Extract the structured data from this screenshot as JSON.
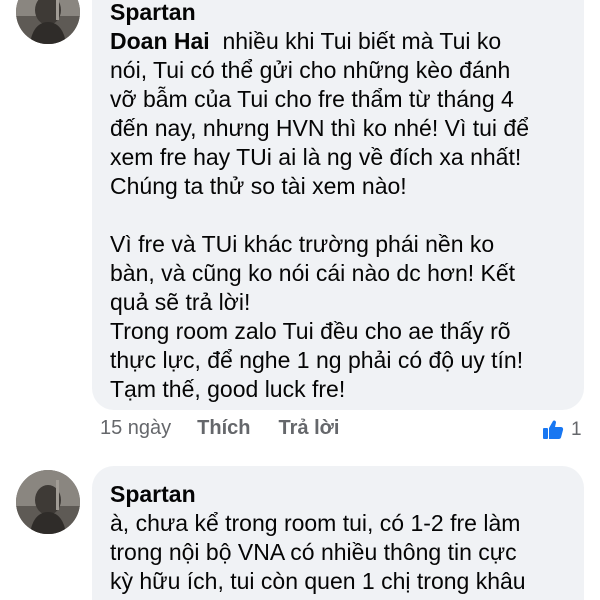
{
  "colors": {
    "bubble_bg": "#f0f2f5",
    "text": "#050505",
    "meta_text": "#65676b",
    "like_blue": "#1877f2"
  },
  "comment1": {
    "author": "Spartan",
    "mention": "Doan Hai",
    "lines": [
      "nhiều khi Tui biết mà Tui ko",
      "nói, Tui có thể gửi cho những kèo đánh",
      "vỡ bẫm của Tui cho fre thẩm từ tháng 4",
      "đến nay, nhưng HVN thì ko nhé! Vì tui để",
      "xem fre hay TUi ai là ng về đích xa nhất!",
      "Chúng ta thử so tài xem nào!",
      "",
      "Vì fre và TUi khác trường phái nền ko",
      "bàn, và cũng ko nói cái nào dc hơn! Kết",
      "quả sẽ trả lời!",
      "Trong room zalo Tui đều cho ae thấy rõ",
      "thực lực, để nghe 1 ng phải có độ uy tín!",
      "Tạm thế, good luck fre!"
    ],
    "time": "15 ngày",
    "like_label": "Thích",
    "reply_label": "Trả lời",
    "reaction_icon": "like-thumb-icon",
    "reaction_count": "1"
  },
  "comment2": {
    "author": "Spartan",
    "lines": [
      "à, chưa kể trong room tui, có 1-2 fre làm",
      "trong nội bộ VNA có nhiều thông tin cực",
      "kỳ hữu ích, tui còn quen 1 chị trong khâu"
    ]
  }
}
